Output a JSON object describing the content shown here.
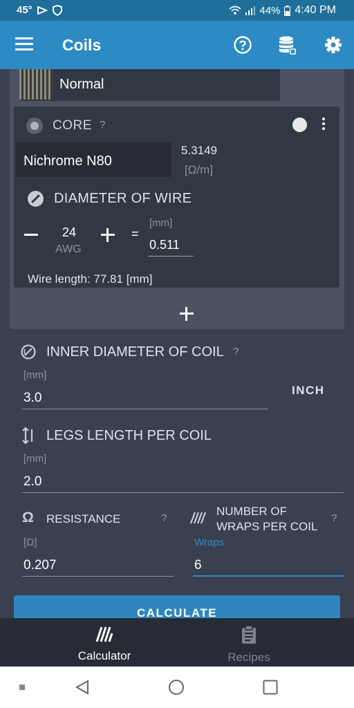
{
  "status_bar": {
    "temperature": "45°",
    "battery": "44%",
    "time": "4:40 PM"
  },
  "app_bar": {
    "title": "Coils",
    "icons": [
      "menu-icon",
      "help-circle-icon",
      "database-icon",
      "gear-icon"
    ]
  },
  "coil_type": {
    "label": "Normal"
  },
  "core": {
    "label": "CORE",
    "help": "?",
    "wire_material": "Nichrome N80",
    "resistivity_value": "5.3149",
    "resistivity_unit": "[Ω/m]",
    "diameter_label": "DIAMETER OF WIRE",
    "awg_value": "24",
    "awg_unit": "AWG",
    "equals": "=",
    "mm_unit": "[mm]",
    "mm_value": "0.511",
    "wire_length": "Wire length: 77.81 [mm]"
  },
  "inner_diameter": {
    "label": "INNER DIAMETER OF COIL",
    "help": "?",
    "unit": "[mm]",
    "value": "3.0",
    "unit_toggle": "INCH"
  },
  "legs_length": {
    "label": "LEGS LENGTH PER COIL",
    "unit": "[mm]",
    "value": "2.0"
  },
  "resistance": {
    "label": "RESISTANCE",
    "help": "?",
    "unit": "[Ω]",
    "value": "0.207"
  },
  "wraps": {
    "label_line1": "NUMBER OF",
    "label_line2": "WRAPS PER COIL",
    "help": "?",
    "unit": "Wraps",
    "value": "6"
  },
  "calculate_button": "CALCULATE",
  "bottom_nav": {
    "calculator": "Calculator",
    "recipes": "Recipes"
  },
  "colors": {
    "accent": "#2d8bc4",
    "background": "#3a4050",
    "card": "#323744"
  }
}
